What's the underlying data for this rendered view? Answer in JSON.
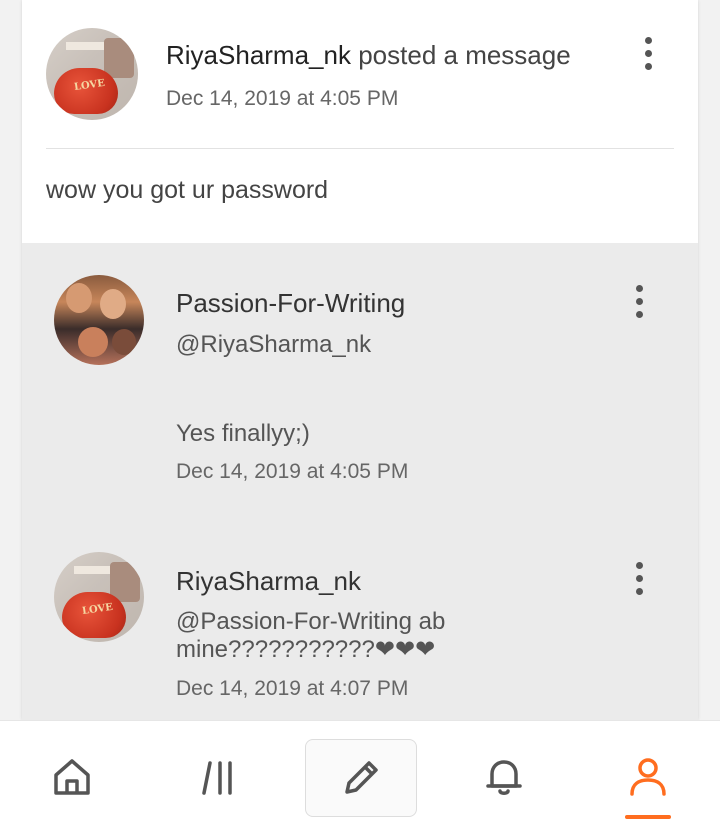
{
  "post": {
    "author": "RiyaSharma_nk",
    "action": "posted a message",
    "timestamp": "Dec 14, 2019 at 4:05 PM",
    "body": "wow you got ur password"
  },
  "replies": [
    {
      "author": "Passion-For-Writing",
      "mention": "@RiyaSharma_nk",
      "text": "Yes finallyy;)",
      "timestamp": "Dec 14, 2019 at 4:05 PM"
    },
    {
      "author": "RiyaSharma_nk",
      "text": "@Passion-For-Writing ab mine???????????❤❤❤",
      "timestamp": "Dec 14, 2019 at 4:07 PM"
    }
  ],
  "tabbar": {
    "items": [
      {
        "icon": "home-icon"
      },
      {
        "icon": "library-icon"
      },
      {
        "icon": "pencil-icon"
      },
      {
        "icon": "bell-icon"
      },
      {
        "icon": "profile-icon",
        "active": true
      }
    ],
    "accent_color": "#ff6d1f"
  }
}
